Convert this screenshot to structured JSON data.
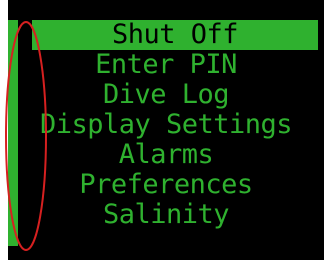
{
  "menu": {
    "items": [
      {
        "label": "Shut Off",
        "selected": true
      },
      {
        "label": "Enter PIN",
        "selected": false
      },
      {
        "label": "Dive Log",
        "selected": false
      },
      {
        "label": "Display Settings",
        "selected": false
      },
      {
        "label": "Alarms",
        "selected": false
      },
      {
        "label": "Preferences",
        "selected": false
      },
      {
        "label": "Salinity",
        "selected": false
      }
    ]
  },
  "colors": {
    "screen_background": "#000000",
    "menu_text": "#2fb12f",
    "selection_highlight": "#2fb12f",
    "annotation": "#d62020"
  }
}
